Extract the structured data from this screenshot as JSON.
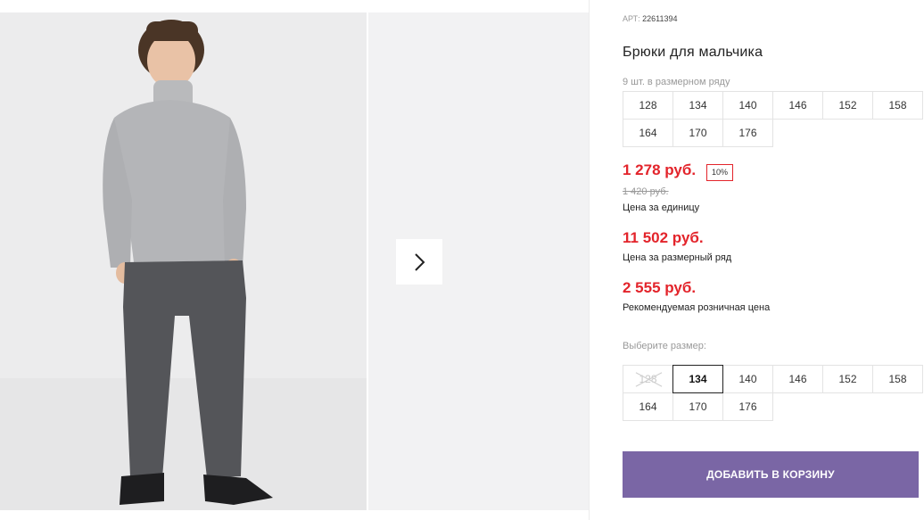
{
  "product": {
    "article_label": "АРТ:",
    "article_number": "22611394",
    "title": "Брюки для мальчика",
    "pack_count": "9 шт. в размерном ряду"
  },
  "pack_sizes": {
    "row1": [
      "128",
      "134",
      "140",
      "146",
      "152",
      "158"
    ],
    "row2": [
      "164",
      "170",
      "176"
    ]
  },
  "pricing": {
    "unit_price": "1 278 руб.",
    "discount": "10%",
    "old_price": "1 420 руб.",
    "unit_label": "Цена за единицу",
    "pack_price": "11 502 руб.",
    "pack_label": "Цена за размерный ряд",
    "retail_price": "2 555 руб.",
    "retail_label": "Рекомендуемая розничная цена"
  },
  "size_select": {
    "label": "Выберите размер:",
    "row1": [
      "128",
      "134",
      "140",
      "146",
      "152",
      "158"
    ],
    "row2": [
      "164",
      "170",
      "176"
    ],
    "selected": "134",
    "unavailable": [
      "128"
    ]
  },
  "actions": {
    "add_to_cart": "ДОБАВИТЬ В КОРЗИНУ"
  },
  "colors": {
    "accent": "#7a66a5",
    "price_red": "#e3242b"
  }
}
